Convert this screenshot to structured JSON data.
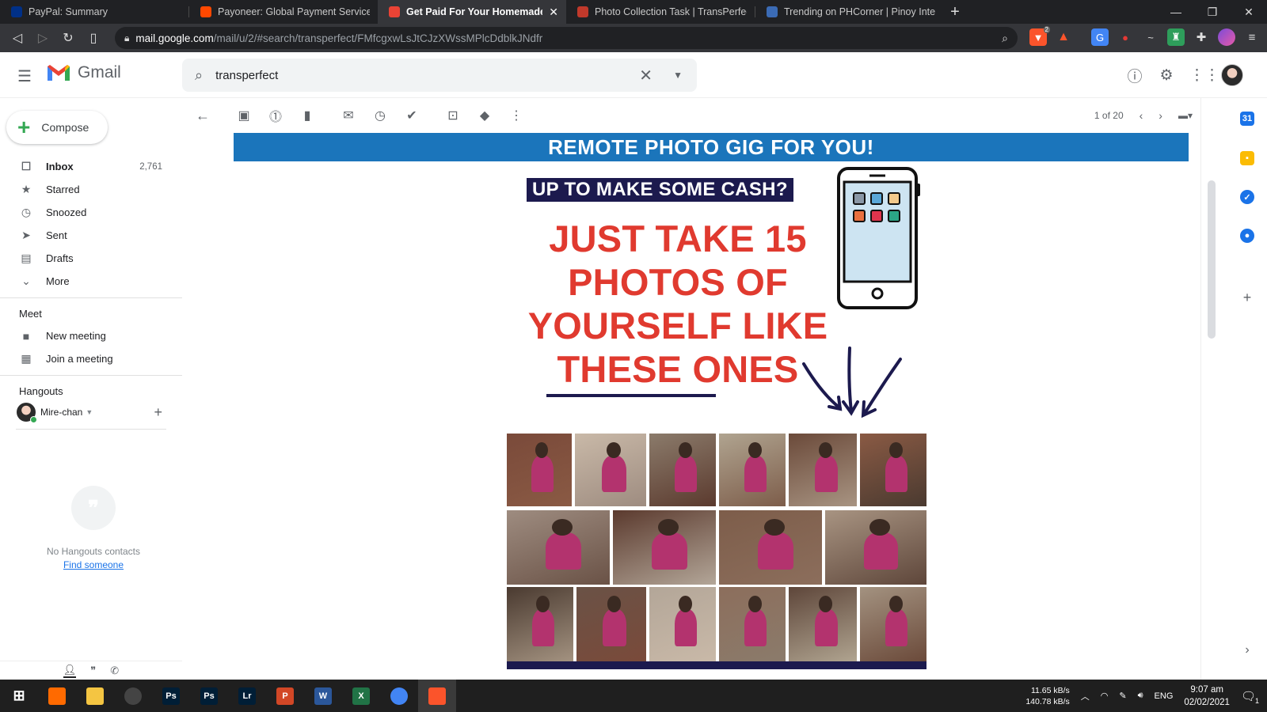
{
  "browser": {
    "tabs": [
      {
        "title": "PayPal: Summary",
        "color": "#003087",
        "active": false
      },
      {
        "title": "Payoneer: Global Payment Service",
        "color": "#ff4800",
        "active": false
      },
      {
        "title": "Get Paid For Your Homemade",
        "color": "#ea4335",
        "active": true
      },
      {
        "title": "Photo Collection Task | TransPerfect",
        "color": "#c0392b",
        "active": false
      },
      {
        "title": "Trending on PHCorner | Pinoy Internet",
        "color": "#3b6bb5",
        "active": false
      }
    ],
    "url_host": "mail.google.com",
    "url_path": "/mail/u/2/#search/transperfect/FMfcgxwLsJtCJzXWssMPlcDdblkJNdfr",
    "ext_badge": "2"
  },
  "gmail": {
    "logo_text": "Gmail",
    "search_value": "transperfect",
    "compose_label": "Compose",
    "nav": [
      {
        "label": "Inbox",
        "icon": "inbox-icon",
        "glyph": "☐",
        "count": "2,761",
        "bold": true
      },
      {
        "label": "Starred",
        "icon": "star-icon",
        "glyph": "★",
        "count": "",
        "bold": false
      },
      {
        "label": "Snoozed",
        "icon": "clock-icon",
        "glyph": "◷",
        "count": "",
        "bold": false
      },
      {
        "label": "Sent",
        "icon": "send-icon",
        "glyph": "➤",
        "count": "",
        "bold": false
      },
      {
        "label": "Drafts",
        "icon": "draft-icon",
        "glyph": "▤",
        "count": "",
        "bold": false
      },
      {
        "label": "More",
        "icon": "chevron-down-icon",
        "glyph": "⌄",
        "count": "",
        "bold": false
      }
    ],
    "meet_title": "Meet",
    "meet": [
      {
        "label": "New meeting",
        "icon": "video-icon",
        "glyph": "■"
      },
      {
        "label": "Join a meeting",
        "icon": "keyboard-icon",
        "glyph": "▦"
      }
    ],
    "hangouts_title": "Hangouts",
    "hangouts_user": "Mire-chan",
    "no_contacts": "No Hangouts contacts",
    "find_someone": "Find someone",
    "pager": "1 of 20"
  },
  "email": {
    "banner": "REMOTE PHOTO GIG FOR YOU!",
    "cash_line": "UP TO MAKE SOME CASH?",
    "headline": [
      "JUST TAKE 15",
      "PHOTOS OF",
      "YOURSELF LIKE",
      "THESE ONES"
    ],
    "colors": {
      "banner": "#1b75bb",
      "headline": "#e03a2f",
      "navy": "#1c1a4e"
    }
  },
  "taskbar": {
    "net_up": "11.65 kB/s",
    "net_down": "140.78 kB/s",
    "lang": "ENG",
    "time": "9:07 am",
    "date": "02/02/2021",
    "notif_count": "1",
    "apps": [
      {
        "name": "search-app",
        "label": "",
        "color": "#ff6a00"
      },
      {
        "name": "file-explorer-app",
        "label": "",
        "color": "#f4c542"
      },
      {
        "name": "obs-app",
        "label": "",
        "color": "#444"
      },
      {
        "name": "photoshop-app",
        "label": "Ps",
        "color": "#001e36"
      },
      {
        "name": "photoshop-2-app",
        "label": "Ps",
        "color": "#001e36"
      },
      {
        "name": "lightroom-app",
        "label": "Lr",
        "color": "#001e36"
      },
      {
        "name": "powerpoint-app",
        "label": "P",
        "color": "#d24726"
      },
      {
        "name": "word-app",
        "label": "W",
        "color": "#2b579a"
      },
      {
        "name": "excel-app",
        "label": "X",
        "color": "#217346"
      },
      {
        "name": "chrome-app",
        "label": "",
        "color": "#4285f4"
      },
      {
        "name": "brave-app",
        "label": "",
        "color": "#fb542b"
      }
    ]
  }
}
